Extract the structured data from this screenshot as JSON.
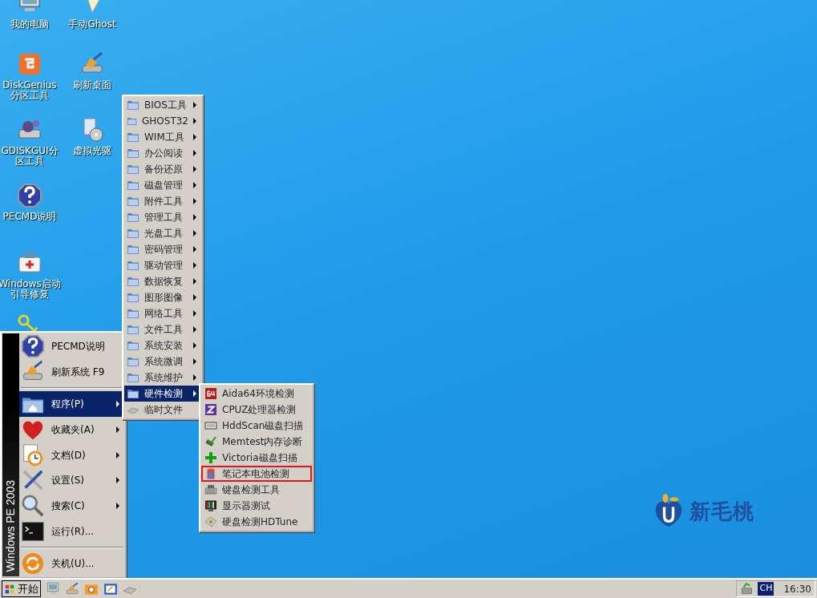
{
  "desktop_icons": [
    {
      "label": "我的电脑"
    },
    {
      "label": "手动Ghost"
    },
    {
      "label": "DiskGenius分区工具"
    },
    {
      "label": "刷新桌面"
    },
    {
      "label": "GDISKGUI分区工具"
    },
    {
      "label": "虚拟光驱"
    },
    {
      "label": "PECMD说明"
    },
    {
      "label": "Windows启动引导修复"
    }
  ],
  "start_menu": {
    "banner": "Windows PE 2003",
    "items": [
      {
        "kind": "item",
        "label": "PECMD说明",
        "has_submenu": false,
        "selected": false
      },
      {
        "kind": "item",
        "label": "刷新系统 F9",
        "has_submenu": false,
        "selected": false
      },
      {
        "kind": "separator"
      },
      {
        "kind": "item",
        "label": "程序(P)",
        "has_submenu": true,
        "selected": true
      },
      {
        "kind": "item",
        "label": "收藏夹(A)",
        "has_submenu": true,
        "selected": false
      },
      {
        "kind": "item",
        "label": "文档(D)",
        "has_submenu": true,
        "selected": false
      },
      {
        "kind": "item",
        "label": "设置(S)",
        "has_submenu": true,
        "selected": false
      },
      {
        "kind": "item",
        "label": "搜索(C)",
        "has_submenu": true,
        "selected": false
      },
      {
        "kind": "item",
        "label": "运行(R)...",
        "has_submenu": false,
        "selected": false
      },
      {
        "kind": "separator"
      },
      {
        "kind": "item",
        "label": "关机(U)...",
        "has_submenu": false,
        "selected": false
      }
    ]
  },
  "programs_menu": {
    "items": [
      {
        "kind": "folder",
        "label": "BIOS工具",
        "selected": false
      },
      {
        "kind": "folder",
        "label": "GHOST32",
        "selected": false
      },
      {
        "kind": "folder",
        "label": "WIM工具",
        "selected": false
      },
      {
        "kind": "folder",
        "label": "办公阅读",
        "selected": false
      },
      {
        "kind": "folder",
        "label": "备份还原",
        "selected": false
      },
      {
        "kind": "folder",
        "label": "磁盘管理",
        "selected": false
      },
      {
        "kind": "folder",
        "label": "附件工具",
        "selected": false
      },
      {
        "kind": "folder",
        "label": "管理工具",
        "selected": false
      },
      {
        "kind": "folder",
        "label": "光盘工具",
        "selected": false
      },
      {
        "kind": "folder",
        "label": "密码管理",
        "selected": false
      },
      {
        "kind": "folder",
        "label": "驱动管理",
        "selected": false
      },
      {
        "kind": "folder",
        "label": "数据恢复",
        "selected": false
      },
      {
        "kind": "folder",
        "label": "图形图像",
        "selected": false
      },
      {
        "kind": "folder",
        "label": "网络工具",
        "selected": false
      },
      {
        "kind": "folder",
        "label": "文件工具",
        "selected": false
      },
      {
        "kind": "folder",
        "label": "系统安装",
        "selected": false
      },
      {
        "kind": "folder",
        "label": "系统微调",
        "selected": false
      },
      {
        "kind": "folder",
        "label": "系统维护",
        "selected": false
      },
      {
        "kind": "folder",
        "label": "硬件检测",
        "selected": true
      },
      {
        "kind": "file",
        "label": "临时文件",
        "selected": false
      }
    ]
  },
  "hardware_menu": {
    "items": [
      {
        "label": "Aida64环境检测",
        "highlighted": false
      },
      {
        "label": "CPUZ处理器检测",
        "highlighted": false
      },
      {
        "label": "HddScan磁盘扫描",
        "highlighted": false
      },
      {
        "label": "Memtest内存诊断",
        "highlighted": false
      },
      {
        "label": "Victoria磁盘扫描",
        "highlighted": false
      },
      {
        "label": "笔记本电池检测",
        "highlighted": true
      },
      {
        "label": "键盘检测工具",
        "highlighted": false
      },
      {
        "label": "显示器测试",
        "highlighted": false
      },
      {
        "label": "硬盘检测HDTune",
        "highlighted": false
      }
    ]
  },
  "logo": {
    "text": "新毛桃"
  },
  "taskbar": {
    "start_button": "开始",
    "language": "CH",
    "time": "16:30"
  }
}
